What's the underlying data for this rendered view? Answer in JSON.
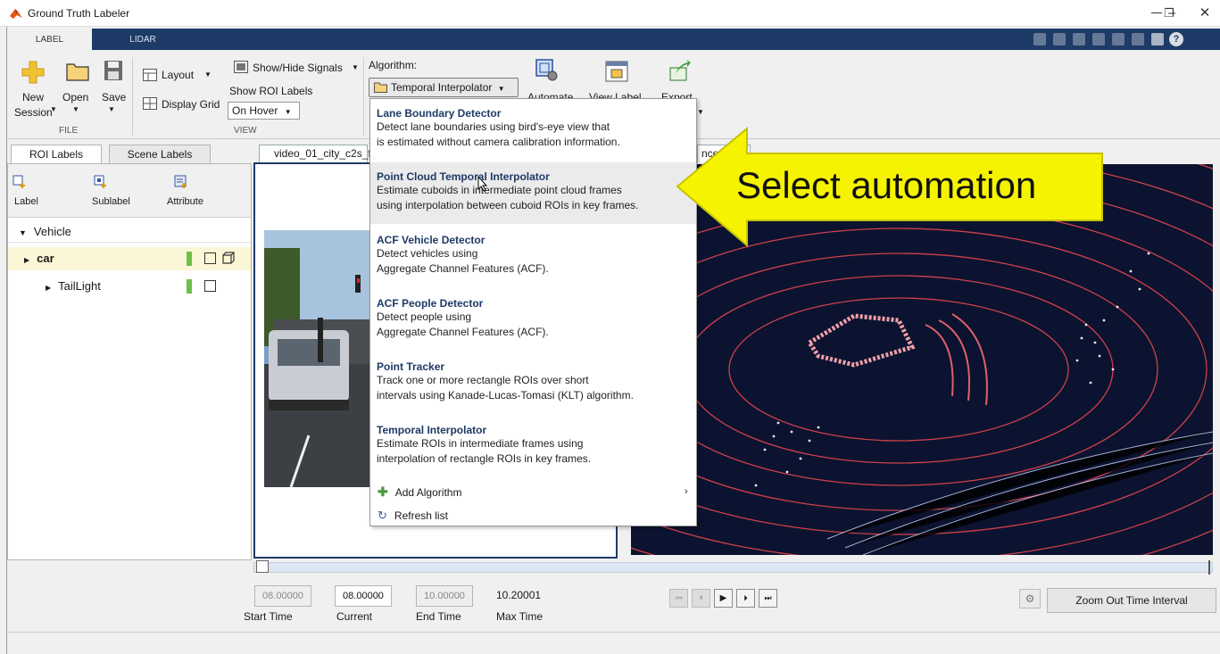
{
  "window": {
    "title": "Ground Truth Labeler"
  },
  "ribbon_tabs": [
    "LABEL",
    "LIDAR"
  ],
  "file_section": {
    "new_label": "New",
    "new_sub": "Session",
    "open_label": "Open",
    "save_label": "Save",
    "section": "FILE"
  },
  "view_section": {
    "layout_label": "Layout",
    "display_grid_label": "Display Grid",
    "show_hide_signals_label": "Show/Hide Signals",
    "show_roi_labels_label": "Show ROI Labels",
    "roi_mode_value": "On Hover",
    "section": "VIEW"
  },
  "algorithm": {
    "label": "Algorithm:",
    "selected": "Temporal Interpolator",
    "automate_label": "Automate",
    "view_label_label": "View Label",
    "export_label": "Export"
  },
  "left_panel": {
    "tabs": [
      "ROI Labels",
      "Scene Labels"
    ],
    "tools": [
      "Label",
      "Sublabel",
      "Attribute"
    ],
    "group": "Vehicle",
    "label_car": "car",
    "sublabel_taillight": "TailLight",
    "colors": {
      "car": "#6fc04a",
      "taillight": "#6fc04a"
    }
  },
  "viewer": {
    "video_tab": "video_01_city_c2s_f",
    "lidar_tab_suffix": "nce"
  },
  "algorithm_menu": {
    "items": [
      {
        "title": "Lane Boundary Detector",
        "desc1": "Detect lane boundaries using bird's-eye view that",
        "desc2": "is estimated without camera calibration information."
      },
      {
        "title": "Point Cloud Temporal Interpolator",
        "desc1": "Estimate cuboids in intermediate point cloud frames",
        "desc2": "using interpolation between cuboid ROIs in key frames."
      },
      {
        "title": "ACF Vehicle Detector",
        "desc1": "Detect vehicles using",
        "desc2": "Aggregate Channel Features (ACF)."
      },
      {
        "title": "ACF People Detector",
        "desc1": "Detect people using",
        "desc2": "Aggregate Channel Features (ACF)."
      },
      {
        "title": "Point Tracker",
        "desc1": "Track one or more rectangle ROIs over short",
        "desc2": "intervals using Kanade-Lucas-Tomasi (KLT) algorithm."
      },
      {
        "title": "Temporal Interpolator",
        "desc1": "Estimate ROIs in intermediate frames using",
        "desc2": "interpolation of rectangle ROIs in key frames."
      }
    ],
    "add_algorithm": "Add Algorithm",
    "refresh_list": "Refresh list"
  },
  "callout": {
    "text": "Select automation",
    "color": "#f6f300"
  },
  "timeline": {
    "start_time": "08.00000",
    "start_label": "Start Time",
    "current": "08.00000",
    "current_label": "Current",
    "end_time": "10.00000",
    "end_label": "End Time",
    "max_time": "10.20001",
    "max_label": "Max Time",
    "zoom_label": "Zoom Out Time Interval"
  },
  "colors": {
    "accent": "#1e3a66",
    "lidar_bg": "#0b1330",
    "lidar_ring": "#d0404a",
    "point": "#f0a0a8"
  }
}
